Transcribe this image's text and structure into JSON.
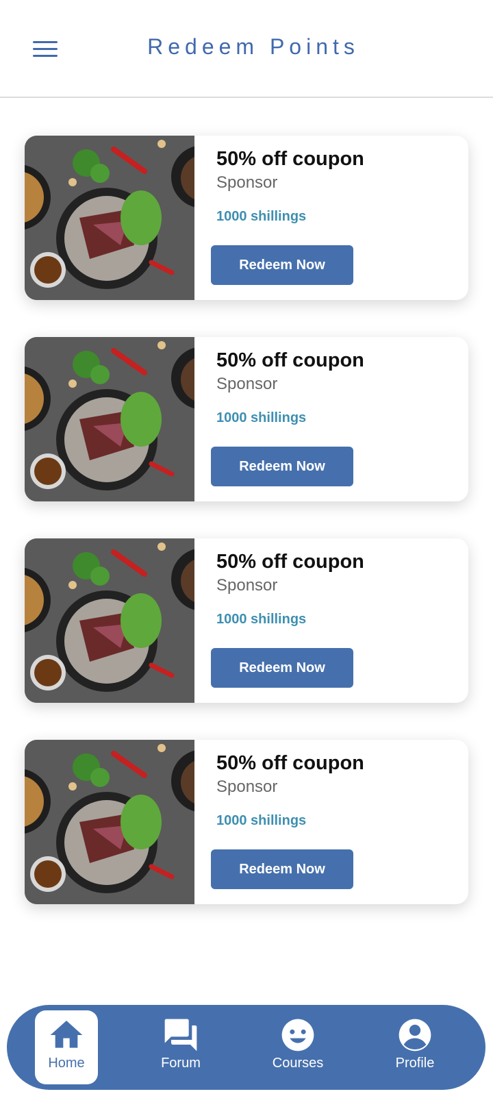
{
  "header": {
    "title": "Redeem Points"
  },
  "coupons": [
    {
      "title": "50% off coupon",
      "sponsor": "Sponsor",
      "points": "1000 shillings",
      "button": "Redeem Now"
    },
    {
      "title": "50% off coupon",
      "sponsor": "Sponsor",
      "points": "1000 shillings",
      "button": "Redeem Now"
    },
    {
      "title": "50% off coupon",
      "sponsor": "Sponsor",
      "points": "1000 shillings",
      "button": "Redeem Now"
    },
    {
      "title": "50% off coupon",
      "sponsor": "Sponsor",
      "points": "1000 shillings",
      "button": "Redeem Now"
    }
  ],
  "nav": {
    "items": [
      {
        "label": "Home",
        "icon": "home-icon",
        "active": true
      },
      {
        "label": "Forum",
        "icon": "forum-icon",
        "active": false
      },
      {
        "label": "Courses",
        "icon": "smiley-icon",
        "active": false
      },
      {
        "label": "Profile",
        "icon": "account-circle-icon",
        "active": false
      }
    ]
  },
  "colors": {
    "accent": "#4670ad",
    "title": "#4169ad",
    "points": "#3e8fb0"
  }
}
